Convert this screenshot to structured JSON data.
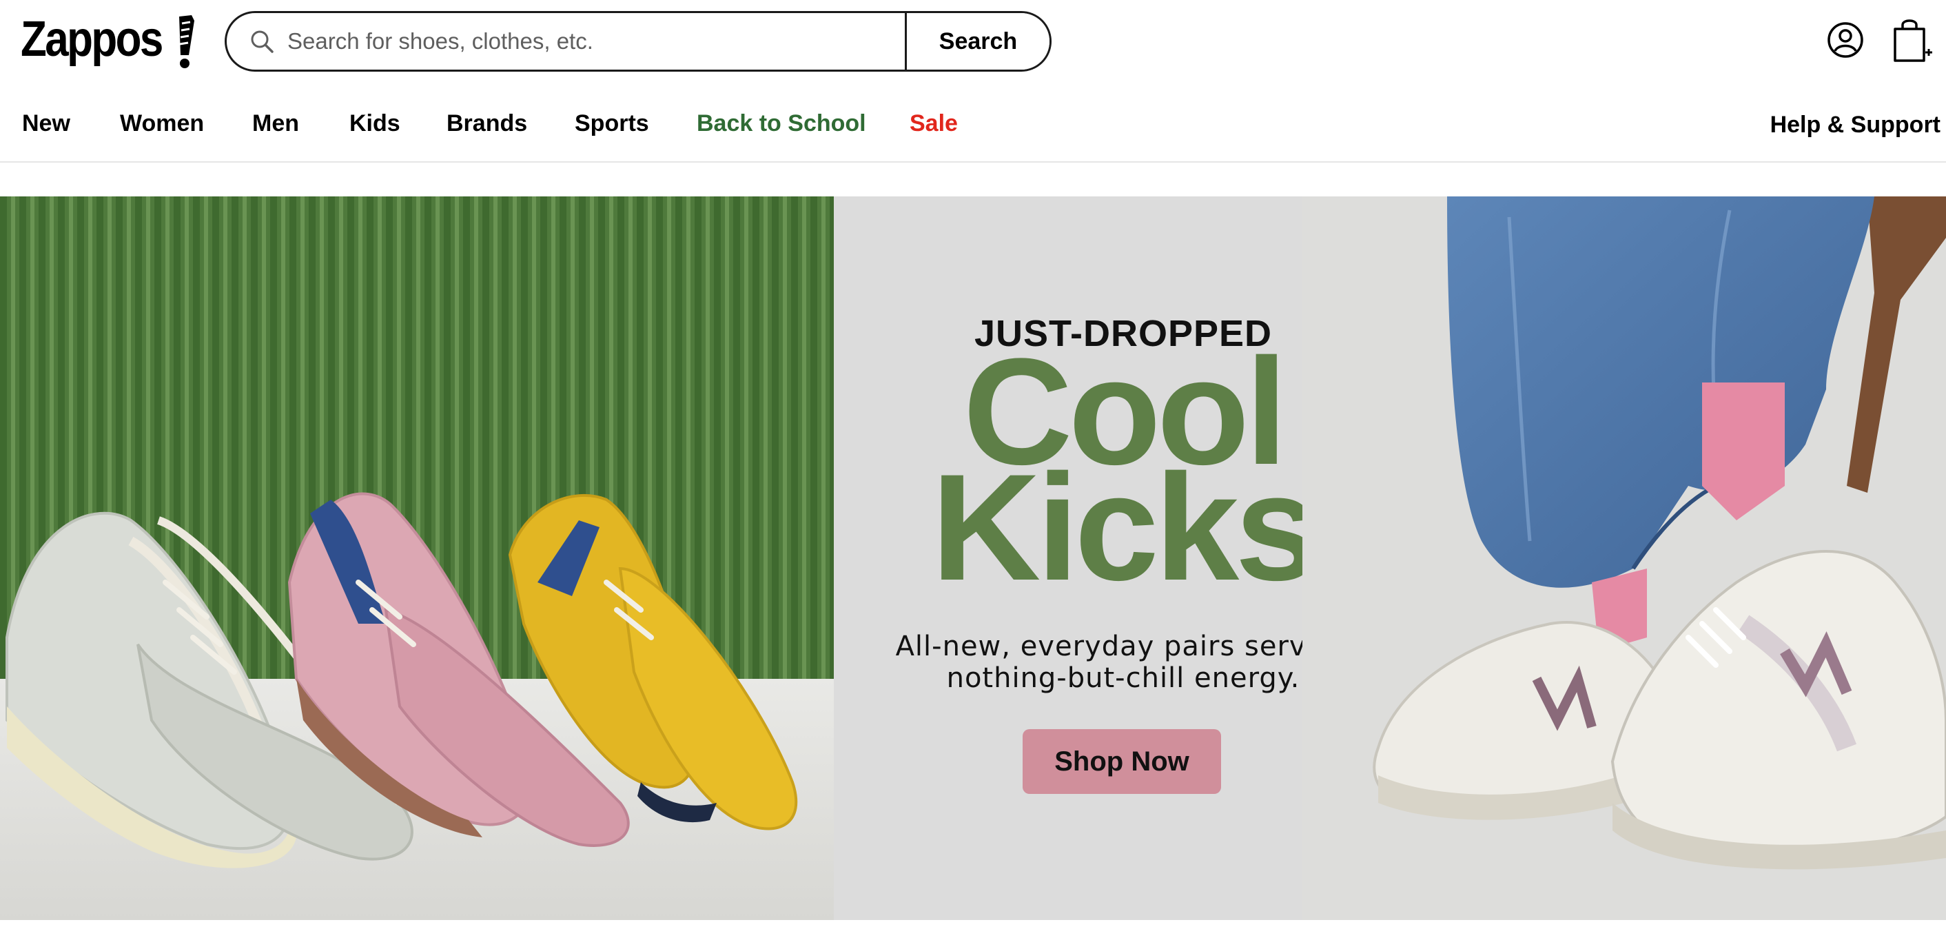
{
  "header": {
    "logo_text": "Zappos",
    "search": {
      "placeholder": "Search for shoes, clothes, etc.",
      "value": "",
      "button_label": "Search"
    }
  },
  "nav": {
    "items": [
      {
        "label": "New"
      },
      {
        "label": "Women"
      },
      {
        "label": "Men"
      },
      {
        "label": "Kids"
      },
      {
        "label": "Brands"
      },
      {
        "label": "Sports"
      },
      {
        "label": "Back to School",
        "color": "#2f6b34"
      },
      {
        "label": "Sale",
        "color": "#e1261c"
      }
    ],
    "help_label": "Help & Support"
  },
  "hero": {
    "eyebrow": "JUST-DROPPED",
    "headline_line1": "Cool",
    "headline_line2": "Kicks",
    "subcopy": "All-new, everyday pairs serving nothing-but-chill energy.",
    "cta_label": "Shop Now",
    "colors": {
      "headline": "#5e7f47",
      "cta_bg": "#d08f9b",
      "panel_bg": "#dcdcdc",
      "wall_green": "#4f7a3c"
    }
  }
}
